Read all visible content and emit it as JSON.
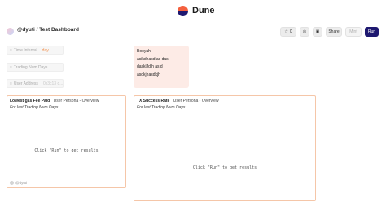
{
  "app": {
    "name": "Dune"
  },
  "header": {
    "breadcrumb": "@dyuti / Test Dashboard"
  },
  "toolbar": {
    "favorite_count": "0",
    "share_label": "Share",
    "mint_label": "Mint",
    "run_label": "Run"
  },
  "parameters": [
    {
      "label": "Time Interval",
      "value": "day"
    },
    {
      "label": "Trading Num Days",
      "value": ""
    },
    {
      "label": "User Address",
      "value": "0x3c13 d..."
    }
  ],
  "text_widget": {
    "lines": [
      "Booyah!",
      "asikdhasd as das",
      "dasklJdjh as d",
      "asdkjhasdkjh"
    ]
  },
  "widgets": [
    {
      "title": "Lowest gas Fee Paid",
      "query": "User Persona - Overview",
      "subtitle": "For last Trading Num Days",
      "message": "Click \"Run\" to get results",
      "owner": "@dyuti"
    },
    {
      "title": "TX Success Rate",
      "query": "User Persona - Overview",
      "subtitle": "For last Trading Num Days",
      "message": "Click \"Run\" to get results"
    }
  ],
  "colors": {
    "brand_navy": "#1e1870",
    "brand_orange": "#f4603e",
    "card_border": "#f5c6a8",
    "text_card_bg": "#fdebe6"
  }
}
